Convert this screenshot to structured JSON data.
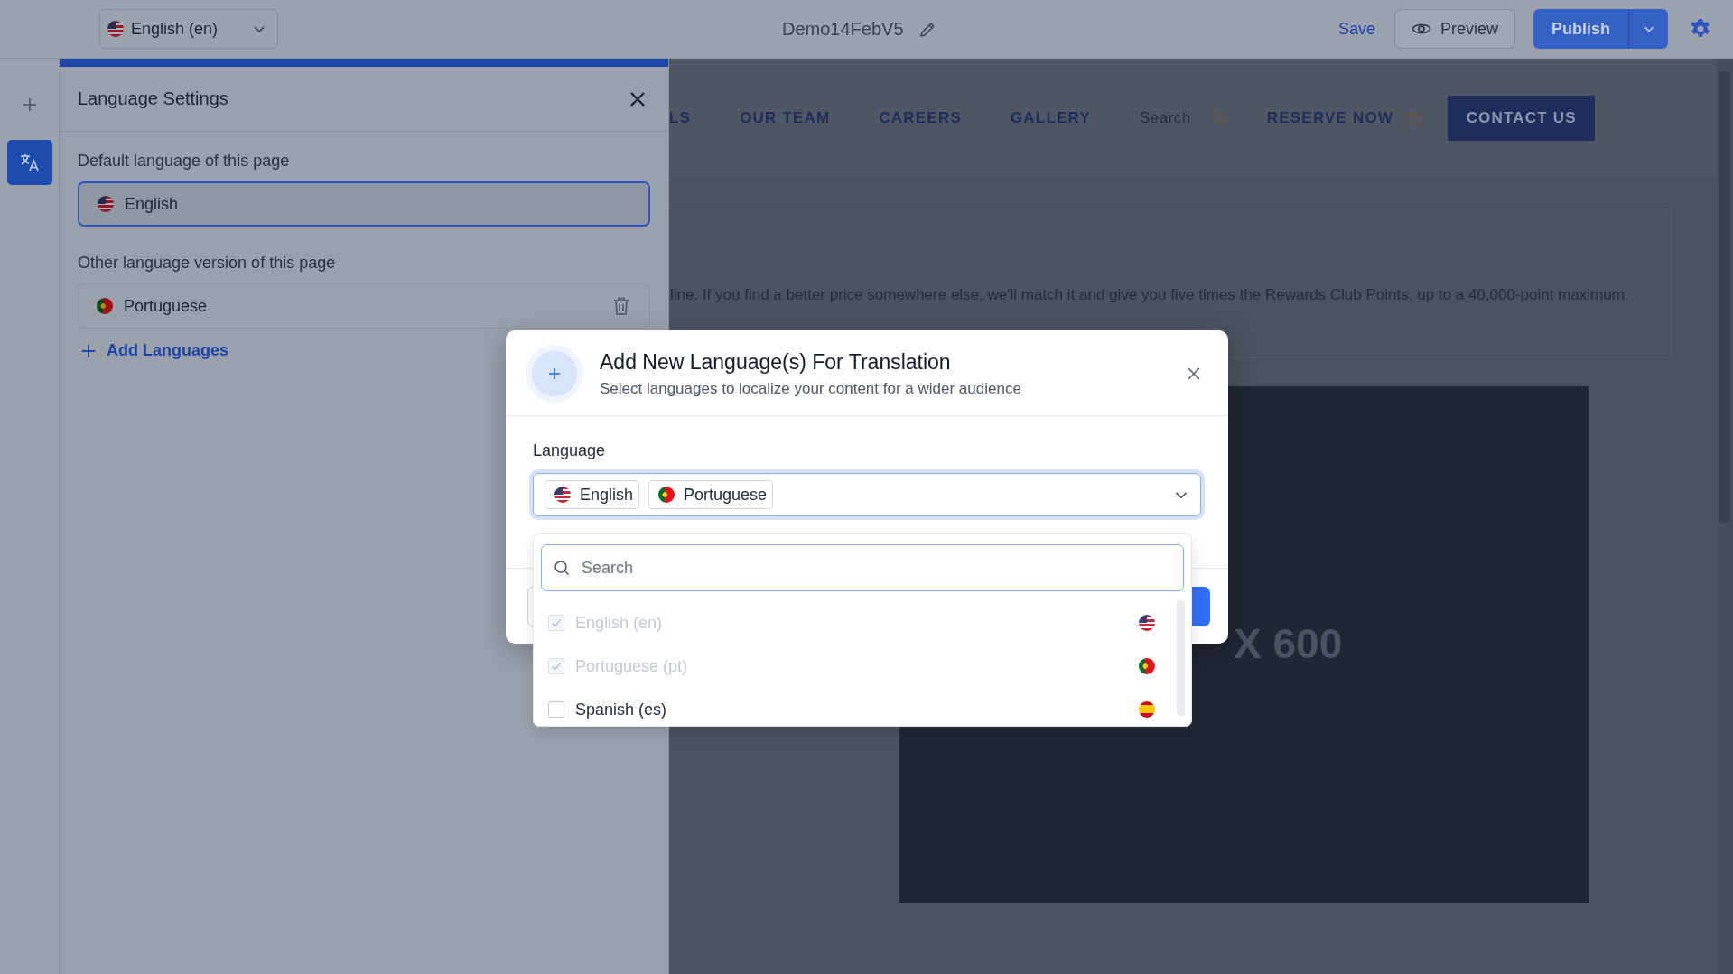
{
  "topbar": {
    "language_select": {
      "label": "English (en)",
      "kind": "us"
    },
    "title": "Demo14FebV5",
    "save": "Save",
    "preview": "Preview",
    "publish": "Publish"
  },
  "rail": [
    {
      "kind": "add",
      "selected": false
    },
    {
      "kind": "translate",
      "selected": true
    }
  ],
  "language_panel": {
    "title": "Language Settings",
    "default_label": "Default language of this page",
    "default_language": {
      "name": "English",
      "kind": "us"
    },
    "other_label": "Other language version of this page",
    "other_languages": [
      {
        "name": "Portuguese",
        "kind": "pt"
      }
    ],
    "add_button": "Add Languages"
  },
  "site": {
    "nav": [
      "LS",
      "OUR TEAM",
      "CAREERS",
      "GALLERY"
    ],
    "search": "Search",
    "reserve": "RESERVE NOW",
    "contact": "CONTACT US",
    "paragraph": "line. If you find a better price somewhere else, we'll match it and give you five times the Rewards Club Points, up to a 40,000-point maximum.",
    "image_text": "X 600"
  },
  "modal": {
    "title": "Add New Language(s) For Translation",
    "subtitle": "Select languages to localize your content for a wider audience",
    "field_label": "Language",
    "chips": [
      {
        "name": "English",
        "kind": "us"
      },
      {
        "name": "Portuguese",
        "kind": "pt"
      }
    ],
    "search_placeholder": "Search",
    "options": [
      {
        "label": "English (en)",
        "kind": "us",
        "checked": true,
        "disabled": true
      },
      {
        "label": "Portuguese (pt)",
        "kind": "pt",
        "checked": true,
        "disabled": true
      },
      {
        "label": "Spanish (es)",
        "kind": "es",
        "checked": false,
        "disabled": false
      }
    ]
  }
}
